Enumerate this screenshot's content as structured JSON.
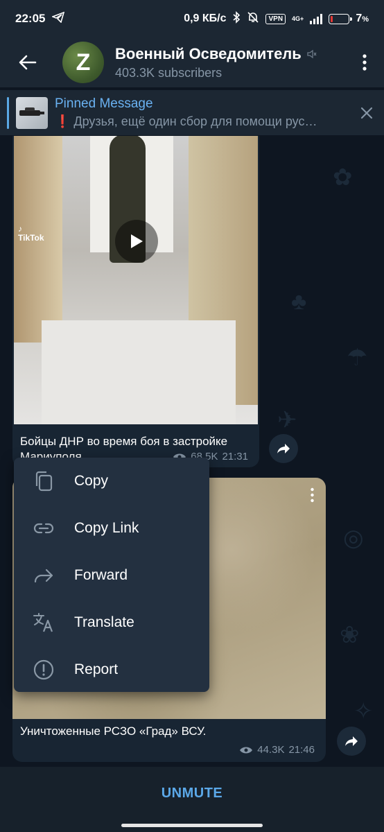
{
  "status_bar": {
    "time": "22:05",
    "net_speed": "0,9 КБ/с",
    "vpn": "VPN",
    "network_type": "4G+",
    "battery_percent": "7",
    "battery_symbol": "%",
    "battery_level": 0.07
  },
  "header": {
    "avatar_letter": "Z",
    "title": "Военный Осведомитель",
    "subtitle": "403.3K subscribers"
  },
  "pinned": {
    "title": "Pinned Message",
    "text": "❗ Друзья, ещё один сбор для помощи рус…"
  },
  "messages": [
    {
      "tiktok_label": "TikTok",
      "caption": "Бойцы ДНР во время боя в застройке Мариуполя",
      "views": "68.5K",
      "time": "21:31"
    },
    {
      "caption": "Уничтоженные РСЗО «Град» ВСУ.",
      "views": "44.3K",
      "time": "21:46"
    }
  ],
  "context_menu": {
    "items": [
      {
        "label": "Copy",
        "icon": "copy-icon"
      },
      {
        "label": "Copy Link",
        "icon": "link-icon"
      },
      {
        "label": "Forward",
        "icon": "forward-icon"
      },
      {
        "label": "Translate",
        "icon": "translate-icon"
      },
      {
        "label": "Report",
        "icon": "report-icon"
      }
    ]
  },
  "bottom_bar": {
    "action": "UNMUTE"
  },
  "colors": {
    "accent": "#5ba8e8",
    "background": "#0e1621",
    "header": "#1c2733",
    "bubble": "#182533",
    "menu": "#233040"
  }
}
